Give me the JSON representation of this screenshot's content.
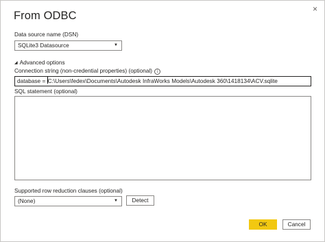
{
  "dialog": {
    "title": "From ODBC",
    "close_glyph": "×"
  },
  "dsn": {
    "label": "Data source name (DSN)",
    "selected": "SQLite3 Datasource",
    "caret_icon": "chevron-down-icon"
  },
  "advanced": {
    "toggle_label": "Advanced options",
    "toggle_icon": "triangle-down-icon",
    "connection_string_label": "Connection string (non-credential properties) (optional)",
    "info_icon": "info-icon",
    "connection_string_prefix": "database = ",
    "connection_string_value": "C:\\Users\\fedex\\Documents\\Autodesk InfraWorks Models\\Autodesk 360\\1418134\\ACV.sqlite",
    "sql_label": "SQL statement (optional)",
    "sql_value": ""
  },
  "reduction": {
    "label": "Supported row reduction clauses (optional)",
    "selected": "(None)",
    "detect_label": "Detect"
  },
  "footer": {
    "ok_label": "OK",
    "cancel_label": "Cancel"
  },
  "colors": {
    "accent": "#f2c811",
    "border": "#8a8886",
    "text": "#252423"
  }
}
